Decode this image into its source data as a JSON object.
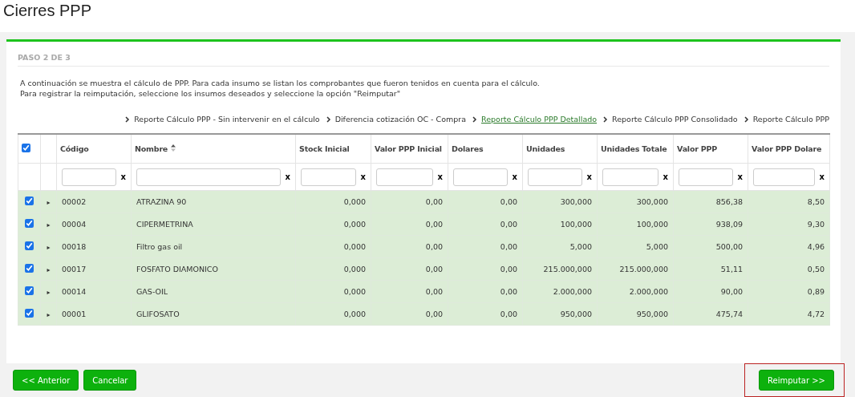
{
  "page_title": "Cierres PPP",
  "step": "PASO 2 DE 3",
  "intro": [
    "A continuación se muestra el cálculo de PPP. Para cada insumo se listan los comprobantes que fueron tenidos en cuenta para el cálculo.",
    "Para registrar la reimputación, seleccione los insumos deseados y seleccione la opción \"Reimputar\""
  ],
  "reports": [
    {
      "label": "Reporte Cálculo PPP - Sin intervenir en el cálculo",
      "selected": false
    },
    {
      "label": "Diferencia cotización OC - Compra",
      "selected": false
    },
    {
      "label": " Reporte Cálculo PPP Detallado",
      "selected": true
    },
    {
      "label": "Reporte Cálculo PPP Consolidado",
      "selected": false
    },
    {
      "label": "Reporte Cálculo PPP",
      "selected": false
    }
  ],
  "table": {
    "select_all": true,
    "columns": [
      {
        "label": "Código",
        "sortable": false,
        "kind": "text",
        "filter_clear": "x"
      },
      {
        "label": "Nombre",
        "sortable": true,
        "kind": "text",
        "filter_clear": "x"
      },
      {
        "label": "Stock Inicial",
        "sortable": false,
        "kind": "number",
        "filter_clear": "x"
      },
      {
        "label": "Valor PPP Inicial",
        "sortable": false,
        "kind": "number",
        "filter_clear": "x"
      },
      {
        "label": "Dolares",
        "sortable": false,
        "kind": "number",
        "filter_clear": "x"
      },
      {
        "label": "Unidades",
        "sortable": false,
        "kind": "number",
        "filter_clear": "x"
      },
      {
        "label": "Unidades Totale",
        "sortable": false,
        "kind": "number",
        "filter_clear": "x"
      },
      {
        "label": "Valor PPP",
        "sortable": false,
        "kind": "number",
        "filter_clear": "x"
      },
      {
        "label": "Valor PPP Dolare",
        "sortable": false,
        "kind": "number",
        "filter_clear": "x"
      }
    ],
    "expand_glyph": "▸",
    "rows": [
      {
        "checked": true,
        "cells": [
          "00002",
          "ATRAZINA 90",
          "0,000",
          "0,00",
          "0,00",
          "300,000",
          "300,000",
          "856,38",
          "8,50"
        ]
      },
      {
        "checked": true,
        "cells": [
          "00004",
          "CIPERMETRINA",
          "0,000",
          "0,00",
          "0,00",
          "100,000",
          "100,000",
          "938,09",
          "9,30"
        ]
      },
      {
        "checked": true,
        "cells": [
          "00018",
          "Filtro gas oil",
          "0,000",
          "0,00",
          "0,00",
          "5,000",
          "5,000",
          "500,00",
          "4,96"
        ]
      },
      {
        "checked": true,
        "cells": [
          "00017",
          "FOSFATO DIAMONICO",
          "0,000",
          "0,00",
          "0,00",
          "215.000,000",
          "215.000,000",
          "51,11",
          "0,50"
        ]
      },
      {
        "checked": true,
        "cells": [
          "00014",
          "GAS-OIL",
          "0,000",
          "0,00",
          "0,00",
          "2.000,000",
          "2.000,000",
          "90,00",
          "0,89"
        ]
      },
      {
        "checked": true,
        "cells": [
          "00001",
          "GLIFOSATO",
          "0,000",
          "0,00",
          "0,00",
          "950,000",
          "950,000",
          "475,74",
          "4,72"
        ]
      }
    ]
  },
  "buttons": [
    {
      "label": "<< Anterior",
      "highlighted": false
    },
    {
      "label": "Cancelar",
      "highlighted": false
    },
    {
      "label": "Reimputar >>",
      "highlighted": true
    }
  ]
}
